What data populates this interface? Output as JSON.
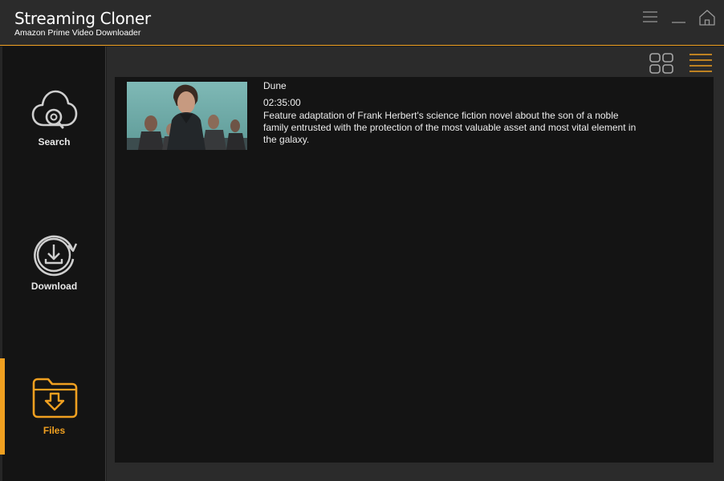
{
  "app": {
    "title": "Streaming Cloner",
    "subtitle": "Amazon Prime Video Downloader"
  },
  "window_controls": {
    "menu": "menu-icon",
    "minimize": "minimize-icon",
    "home": "home-icon"
  },
  "sidebar": {
    "items": [
      {
        "label": "Search",
        "icon": "cloud-search-icon"
      },
      {
        "label": "Download",
        "icon": "download-circle-icon"
      },
      {
        "label": "Files",
        "icon": "folder-download-icon"
      }
    ],
    "active": "Files"
  },
  "view_toggle": {
    "grid": "grid-view-icon",
    "list": "list-view-icon",
    "selected": "list"
  },
  "files": [
    {
      "title": "Dune",
      "duration": "02:35:00",
      "description": "Feature adaptation of Frank Herbert's science fiction novel about the son of a noble family entrusted with the protection of the most valuable asset and most vital element in the galaxy."
    }
  ],
  "colors": {
    "accent": "#f0a020",
    "titlebar": "#2b2b2b",
    "panel": "#141414",
    "icon_gray": "#cfcfcf"
  }
}
